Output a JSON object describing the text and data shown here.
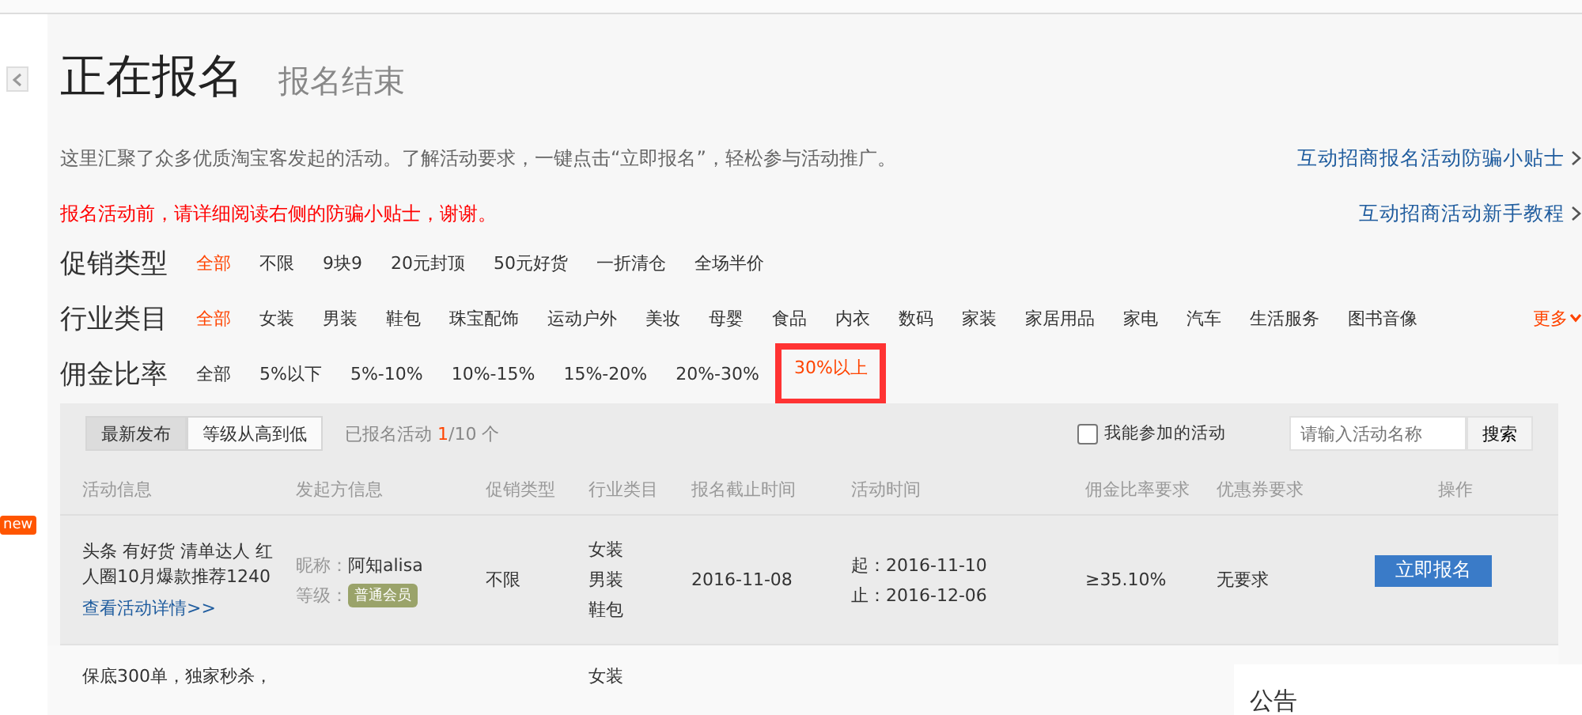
{
  "header": {
    "tabs": [
      {
        "label": "正在报名",
        "selected": true
      },
      {
        "label": "报名结束",
        "selected": false
      }
    ]
  },
  "intro": {
    "text": "这里汇聚了众多优质淘宝客发起的活动。了解活动要求，一键点击“立即报名”，轻松参与活动推广。",
    "warning": "报名活动前，请详细阅读右侧的防骗小贴士，谢谢。"
  },
  "side_links": [
    "互动招商报名活动防骗小贴士",
    "互动招商活动新手教程"
  ],
  "filters": [
    {
      "label": "促销类型",
      "options": [
        {
          "label": "全部",
          "selected": true,
          "highlighted": false
        },
        {
          "label": "不限",
          "selected": false,
          "highlighted": false
        },
        {
          "label": "9块9",
          "selected": false,
          "highlighted": false
        },
        {
          "label": "20元封顶",
          "selected": false,
          "highlighted": false
        },
        {
          "label": "50元好货",
          "selected": false,
          "highlighted": false
        },
        {
          "label": "一折清仓",
          "selected": false,
          "highlighted": false
        },
        {
          "label": "全场半价",
          "selected": false,
          "highlighted": false
        }
      ]
    },
    {
      "label": "行业类目",
      "more": "更多",
      "options": [
        {
          "label": "全部",
          "selected": true,
          "highlighted": false
        },
        {
          "label": "女装",
          "selected": false,
          "highlighted": false
        },
        {
          "label": "男装",
          "selected": false,
          "highlighted": false
        },
        {
          "label": "鞋包",
          "selected": false,
          "highlighted": false
        },
        {
          "label": "珠宝配饰",
          "selected": false,
          "highlighted": false
        },
        {
          "label": "运动户外",
          "selected": false,
          "highlighted": false
        },
        {
          "label": "美妆",
          "selected": false,
          "highlighted": false
        },
        {
          "label": "母婴",
          "selected": false,
          "highlighted": false
        },
        {
          "label": "食品",
          "selected": false,
          "highlighted": false
        },
        {
          "label": "内衣",
          "selected": false,
          "highlighted": false
        },
        {
          "label": "数码",
          "selected": false,
          "highlighted": false
        },
        {
          "label": "家装",
          "selected": false,
          "highlighted": false
        },
        {
          "label": "家居用品",
          "selected": false,
          "highlighted": false
        },
        {
          "label": "家电",
          "selected": false,
          "highlighted": false
        },
        {
          "label": "汽车",
          "selected": false,
          "highlighted": false
        },
        {
          "label": "生活服务",
          "selected": false,
          "highlighted": false
        },
        {
          "label": "图书音像",
          "selected": false,
          "highlighted": false
        }
      ]
    },
    {
      "label": "佣金比率",
      "options": [
        {
          "label": "全部",
          "selected": false,
          "highlighted": false
        },
        {
          "label": "5%以下",
          "selected": false,
          "highlighted": false
        },
        {
          "label": "5%-10%",
          "selected": false,
          "highlighted": false
        },
        {
          "label": "10%-15%",
          "selected": false,
          "highlighted": false
        },
        {
          "label": "15%-20%",
          "selected": false,
          "highlighted": false
        },
        {
          "label": "20%-30%",
          "selected": false,
          "highlighted": false
        },
        {
          "label": "30%以上",
          "selected": true,
          "highlighted": true
        }
      ]
    }
  ],
  "toolbar": {
    "sort_tabs": [
      {
        "label": "最新发布",
        "selected": true
      },
      {
        "label": "等级从高到低",
        "selected": false
      }
    ],
    "count_prefix": "已报名活动",
    "count_done": "1",
    "count_total": "/10 个",
    "checkbox": {
      "label": "我能参加的活动",
      "checked": false
    },
    "search": {
      "placeholder": "请输入活动名称",
      "button": "搜索"
    }
  },
  "table": {
    "columns": [
      "活动信息",
      "发起方信息",
      "促销类型",
      "行业类目",
      "报名截止时间",
      "活动时间",
      "佣金比率要求",
      "优惠券要求",
      "操作"
    ],
    "rows": [
      {
        "title": "头条 有好货 清单达人 红人圈10月爆款推荐1240",
        "detail_link": "查看活动详情>>",
        "nick_label": "昵称：",
        "nick": "阿知alisa",
        "level_label": "等级：",
        "level_badge": "普通会员",
        "promo": "不限",
        "categories": [
          "女装",
          "男装",
          "鞋包"
        ],
        "deadline": "2016-11-08",
        "start": "起：2016-11-10",
        "end": "止：2016-12-06",
        "commission": "≥35.10%",
        "coupon": "无要求",
        "action": "立即报名"
      },
      {
        "title": "保底300单，独家秒杀，",
        "categories": [
          "女装"
        ]
      }
    ]
  },
  "notice": {
    "title": "公告"
  },
  "sidebar": {
    "badge": "new"
  }
}
